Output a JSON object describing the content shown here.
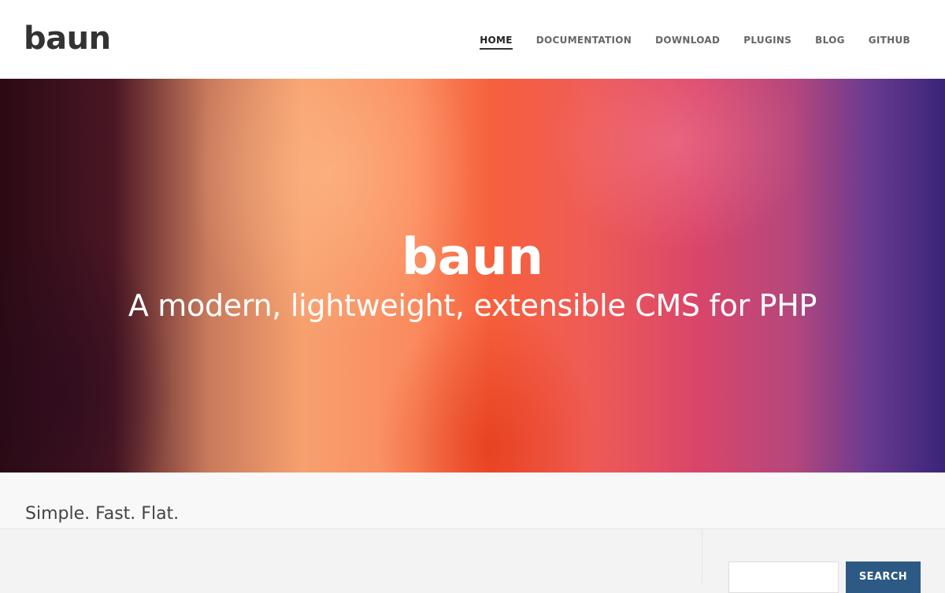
{
  "header": {
    "logo_text": "baun",
    "nav": [
      {
        "label": "HOME",
        "active": true
      },
      {
        "label": "DOCUMENTATION",
        "active": false
      },
      {
        "label": "DOWNLOAD",
        "active": false
      },
      {
        "label": "PLUGINS",
        "active": false
      },
      {
        "label": "BLOG",
        "active": false
      },
      {
        "label": "GITHUB",
        "active": false
      }
    ]
  },
  "hero": {
    "title": "baun",
    "subtitle": "A modern, lightweight, extensible CMS for PHP"
  },
  "tagline": {
    "text": "Simple. Fast. Flat."
  },
  "sidebar": {
    "search": {
      "value": "",
      "button_label": "SEARCH"
    }
  },
  "colors": {
    "header_bg": "#ffffff",
    "logo": "#333333",
    "nav_text": "#666666",
    "nav_active": "#222222",
    "search_button": "#2c5a85",
    "page_bg": "#f3f3f3"
  }
}
